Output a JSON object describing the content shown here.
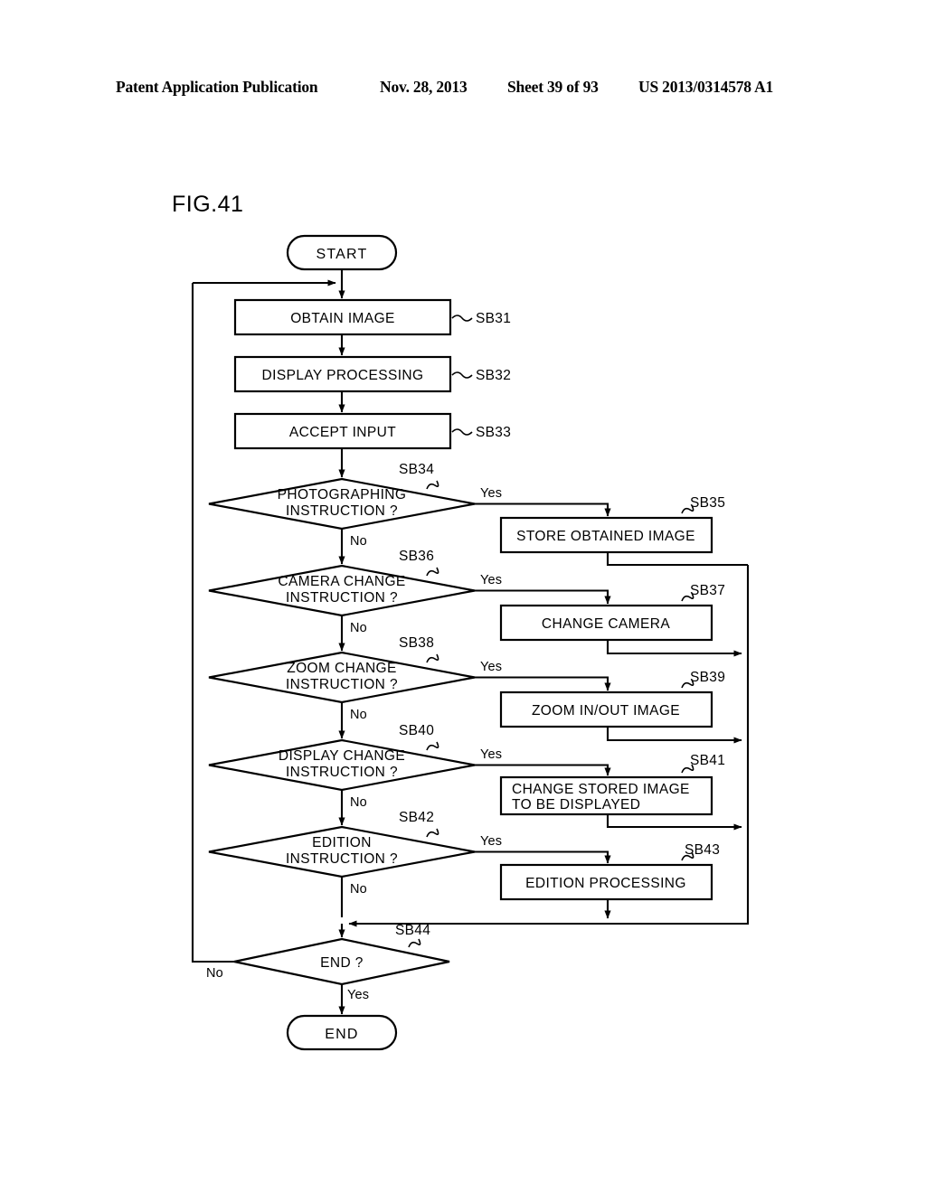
{
  "header": {
    "title": "Patent Application Publication",
    "date": "Nov. 28, 2013",
    "sheet": "Sheet 39 of 93",
    "publication_number": "US 2013/0314578 A1"
  },
  "figure": {
    "label": "FIG.41"
  },
  "chart_data": {
    "type": "diagram",
    "diagram_kind": "flowchart",
    "title": "FIG.41",
    "terminators": [
      {
        "id": "start",
        "text": "START"
      },
      {
        "id": "end",
        "text": "END"
      }
    ],
    "processes": [
      {
        "id": "SB31",
        "text": "OBTAIN IMAGE",
        "step": "SB31"
      },
      {
        "id": "SB32",
        "text": "DISPLAY PROCESSING",
        "step": "SB32"
      },
      {
        "id": "SB33",
        "text": "ACCEPT INPUT",
        "step": "SB33"
      },
      {
        "id": "SB35",
        "text": "STORE OBTAINED IMAGE",
        "step": "SB35"
      },
      {
        "id": "SB37",
        "text": "CHANGE CAMERA",
        "step": "SB37"
      },
      {
        "id": "SB39",
        "text": "ZOOM IN/OUT IMAGE",
        "step": "SB39"
      },
      {
        "id": "SB41",
        "text_line1": "CHANGE STORED IMAGE",
        "text_line2": "TO BE DISPLAYED",
        "step": "SB41"
      },
      {
        "id": "SB43",
        "text": "EDITION PROCESSING",
        "step": "SB43"
      }
    ],
    "decisions": [
      {
        "id": "SB34",
        "line1": "PHOTOGRAPHING",
        "line2": "INSTRUCTION ?",
        "step": "SB34",
        "yes": "Yes",
        "no": "No",
        "yes_target": "SB35",
        "no_target": "SB36"
      },
      {
        "id": "SB36",
        "line1": "CAMERA CHANGE",
        "line2": "INSTRUCTION ?",
        "step": "SB36",
        "yes": "Yes",
        "no": "No",
        "yes_target": "SB37",
        "no_target": "SB38"
      },
      {
        "id": "SB38",
        "line1": "ZOOM CHANGE",
        "line2": "INSTRUCTION ?",
        "step": "SB38",
        "yes": "Yes",
        "no": "No",
        "yes_target": "SB39",
        "no_target": "SB40"
      },
      {
        "id": "SB40",
        "line1": "DISPLAY CHANGE",
        "line2": "INSTRUCTION ?",
        "step": "SB40",
        "yes": "Yes",
        "no": "No",
        "yes_target": "SB41",
        "no_target": "SB42"
      },
      {
        "id": "SB42",
        "line1": "EDITION",
        "line2": "INSTRUCTION ?",
        "step": "SB42",
        "yes": "Yes",
        "no": "No",
        "yes_target": "SB43",
        "no_target": "SB44"
      },
      {
        "id": "SB44",
        "line1": "END ?",
        "line2": "",
        "step": "SB44",
        "yes": "Yes",
        "no": "No",
        "yes_target": "end",
        "no_target": "SB31"
      }
    ],
    "branch_labels": {
      "sb34_yes": "Yes",
      "sb34_no": "No",
      "sb36_yes": "Yes",
      "sb36_no": "No",
      "sb38_yes": "Yes",
      "sb38_no": "No",
      "sb40_yes": "Yes",
      "sb40_no": "No",
      "sb42_yes": "Yes",
      "sb42_no": "No",
      "sb44_yes": "Yes",
      "sb44_no": "No"
    },
    "colors": {
      "ink": "#000000",
      "paper": "#ffffff"
    }
  }
}
